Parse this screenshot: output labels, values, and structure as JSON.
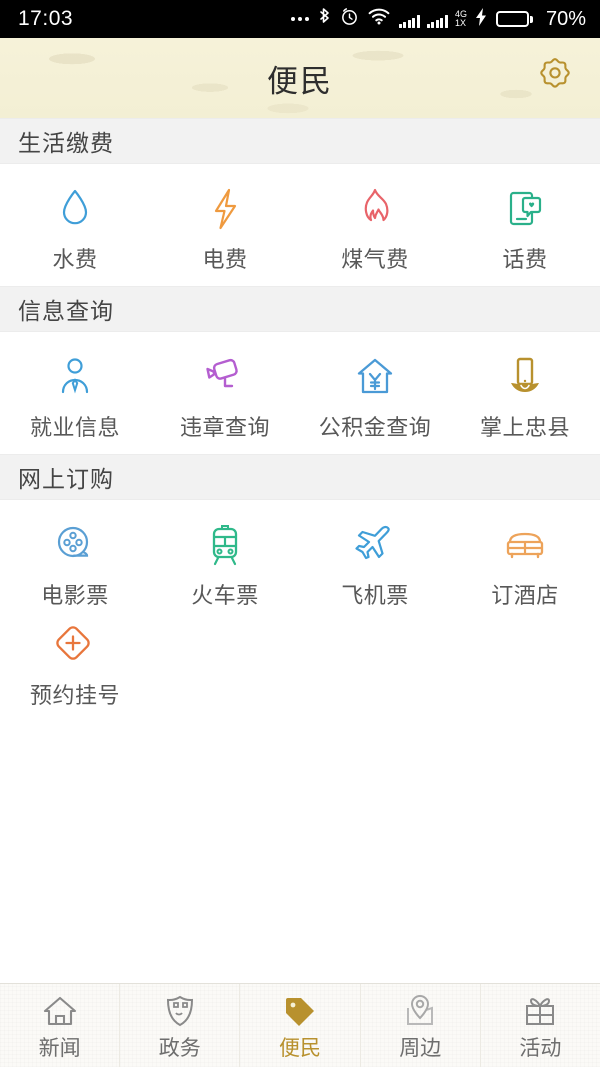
{
  "statusbar": {
    "time": "17:03",
    "network_label_top": "4G",
    "network_label_bottom": "1X",
    "battery_percent": "70%",
    "battery_level": 70,
    "icons": [
      "more-dots-icon",
      "bluetooth-icon",
      "alarm-icon",
      "wifi-icon",
      "signal-bars-icon",
      "charging-bolt-icon",
      "battery-icon"
    ]
  },
  "header": {
    "title": "便民",
    "settings_icon": "gear-icon",
    "bg_color": "#f5f1d7",
    "accent_color": "#b8912e"
  },
  "sections": [
    {
      "title": "生活缴费",
      "items": [
        {
          "label": "水费",
          "icon": "water-drop-icon",
          "color": "#3f9ed8"
        },
        {
          "label": "电费",
          "icon": "lightning-bolt-icon",
          "color": "#ef9a3f"
        },
        {
          "label": "煤气费",
          "icon": "flame-icon",
          "color": "#e8646a"
        },
        {
          "label": "话费",
          "icon": "phone-chat-heart-icon",
          "color": "#2ab08a"
        }
      ]
    },
    {
      "title": "信息查询",
      "items": [
        {
          "label": "就业信息",
          "icon": "person-tie-icon",
          "color": "#3f9ed8"
        },
        {
          "label": "违章查询",
          "icon": "surveillance-camera-icon",
          "color": "#b45ed0"
        },
        {
          "label": "公积金查询",
          "icon": "house-yuan-icon",
          "color": "#4a9ad6"
        },
        {
          "label": "掌上忠县",
          "icon": "phone-in-hand-icon",
          "color": "#b8912e"
        }
      ]
    },
    {
      "title": "网上订购",
      "items": [
        {
          "label": "电影票",
          "icon": "film-reel-icon",
          "color": "#5a9fd4"
        },
        {
          "label": "火车票",
          "icon": "train-icon",
          "color": "#2fb98a"
        },
        {
          "label": "飞机票",
          "icon": "airplane-icon",
          "color": "#3f9ed8"
        },
        {
          "label": "订酒店",
          "icon": "bed-icon",
          "color": "#eda35a"
        },
        {
          "label": "预约挂号",
          "icon": "medical-cross-icon",
          "color": "#e8763c"
        }
      ]
    }
  ],
  "tabbar": {
    "active_index": 2,
    "active_color": "#b8912e",
    "inactive_color": "#6e6e6e",
    "items": [
      {
        "label": "新闻",
        "icon": "home-icon"
      },
      {
        "label": "政务",
        "icon": "shield-icon"
      },
      {
        "label": "便民",
        "icon": "tag-icon"
      },
      {
        "label": "周边",
        "icon": "map-pin-icon"
      },
      {
        "label": "活动",
        "icon": "gift-icon"
      }
    ]
  }
}
